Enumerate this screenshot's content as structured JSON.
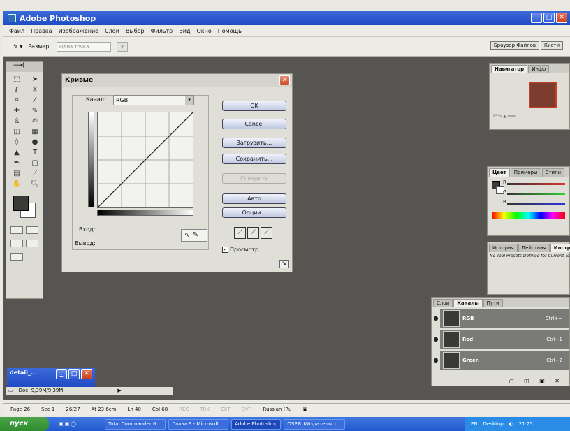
{
  "app": {
    "title": "Adobe Photoshop"
  },
  "menu": [
    "Файл",
    "Правка",
    "Изображение",
    "Слой",
    "Выбор",
    "Фильтр",
    "Вид",
    "Окно",
    "Помощь"
  ],
  "options": {
    "size_label": "Размер:",
    "size_value": "Одна точка",
    "well_tabs": [
      "Браузер Файлов",
      "Кисти"
    ]
  },
  "curves": {
    "title": "Кривые",
    "channel_label": "Канал:",
    "channel_value": "RGB",
    "buttons": {
      "ok": "OK",
      "cancel": "Cancel",
      "load": "Загрузить...",
      "save": "Сохранить...",
      "smooth": "Сгладить",
      "auto": "Авто",
      "options": "Опции..."
    },
    "input_label": "Вход:",
    "output_label": "Вывод:",
    "preview_label": "Просмотр",
    "preview_checked": true
  },
  "palettes": {
    "navigator_tabs": [
      "Навигатор",
      "Инфо"
    ],
    "navigator_zoom": "25%",
    "color_tabs": [
      "Цвет",
      "Примеры",
      "Стили"
    ],
    "color_sliders": [
      "R",
      "G",
      "B"
    ],
    "history_tabs": [
      "История",
      "Действия",
      "Инструменты"
    ],
    "history_text": "No Tool Presets Defined for Current Tool.",
    "layers_tabs": [
      "Слои",
      "Каналы",
      "Пути"
    ],
    "channels": [
      {
        "name": "RGB",
        "shortcut": "Ctrl+~"
      },
      {
        "name": "Red",
        "shortcut": "Ctrl+1"
      },
      {
        "name": "Green",
        "shortcut": "Ctrl+2"
      }
    ]
  },
  "document": {
    "title": "detail_...",
    "status": "Doc: 9,39M/9,39M"
  },
  "statusbar": {
    "page": "Page 26",
    "sec": "Sec 1",
    "pages": "26/27",
    "at": "At 23,6cm",
    "ln": "Ln 40",
    "col": "Col 68",
    "flags": [
      "REC",
      "TRK",
      "EXT",
      "OVR"
    ],
    "lang": "Russian (Ru"
  },
  "taskbar": {
    "start": "пуск",
    "tasks": [
      "Total Commander 6....",
      "Глава 9 - Microsoft ...",
      "Adobe Photoshop",
      "OSP.RU/Издательст..."
    ],
    "lang": "EN",
    "desktop": "Desktop",
    "time": "21:25"
  }
}
